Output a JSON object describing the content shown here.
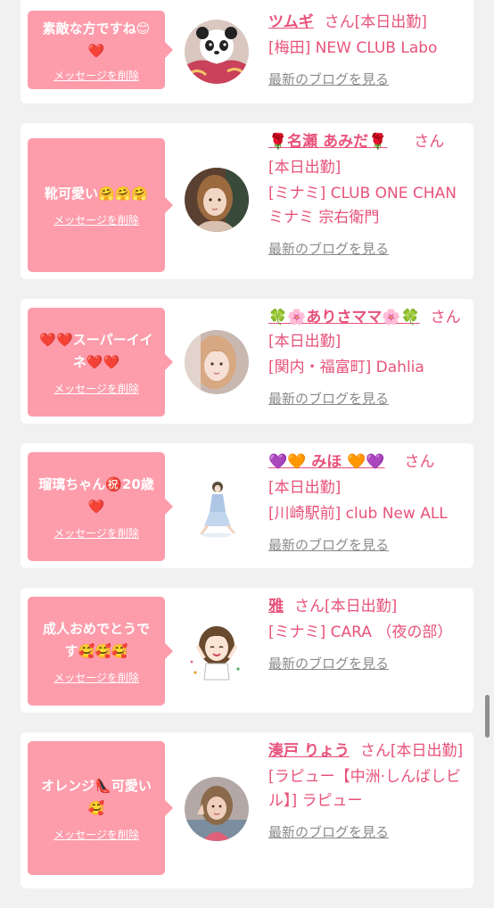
{
  "delete_label": "メッセージを削除",
  "blog_label": "最新のブログを見る",
  "san_label": "さん",
  "colors": {
    "bubble": "#fd9cab",
    "accent": "#e8527a",
    "muted": "#8a8a8a",
    "background": "#f1f1f1"
  },
  "cards": [
    {
      "message": "素敵な方ですね😊❤️",
      "name": "ツムギ",
      "status": "[本日出勤]",
      "shop": "[梅田] NEW CLUB Labo",
      "avatar_icon": "panda-avatar-icon"
    },
    {
      "message": "靴可愛い🤗🤗🤗",
      "name": "🌹名瀬 あみだ🌹",
      "status": "[本日出勤]",
      "shop": "[ミナミ] CLUB ONE CHAN ミナミ 宗右衛門",
      "avatar_icon": "woman-photo-avatar-icon"
    },
    {
      "message": "❤️❤️スーパーイイネ❤️❤️",
      "name": "🍀🌸ありさママ🌸🍀",
      "status": "[本日出勤]",
      "shop": "[関内・福富町] Dahlia",
      "avatar_icon": "woman-photo-avatar-icon"
    },
    {
      "message": "瑠璃ちゃん㊗️20歳❤️",
      "name": "💜🧡 みほ 🧡💜",
      "status": "[本日出勤]",
      "shop": "[川崎駅前] club New ALL",
      "avatar_icon": "dress-figure-avatar-icon"
    },
    {
      "message": "成人おめでとうです🥰🥰🥰",
      "name": "雅",
      "status": "[本日出勤]",
      "shop": "[ミナミ] CARA （夜の部）",
      "avatar_icon": "cartoon-girl-avatar-icon"
    },
    {
      "message": "オレンジ👠可愛い🥰",
      "name": "湊戸 りょう",
      "status": "[本日出勤]",
      "shop": "[ラピュー【中洲·しんばしビル】] ラピュー",
      "avatar_icon": "woman-photo-avatar-icon"
    }
  ]
}
